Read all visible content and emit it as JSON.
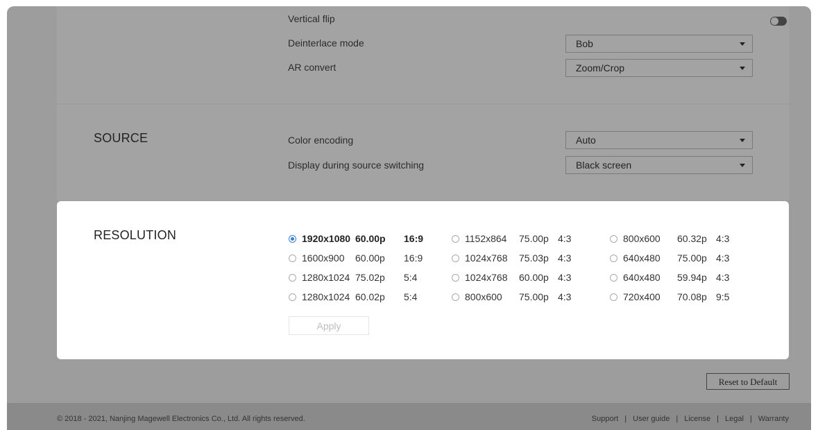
{
  "video": {
    "vertical_flip_label": "Vertical flip",
    "vertical_flip_on": false,
    "deinterlace_label": "Deinterlace mode",
    "deinterlace_value": "Bob",
    "ar_label": "AR convert",
    "ar_value": "Zoom/Crop"
  },
  "source": {
    "title": "SOURCE",
    "color_encoding_label": "Color encoding",
    "color_encoding_value": "Auto",
    "switching_label": "Display during source switching",
    "switching_value": "Black screen"
  },
  "resolution": {
    "title": "RESOLUTION",
    "selected_index": 0,
    "options": [
      {
        "res": "1920x1080",
        "fps": "60.00p",
        "aspect": "16:9"
      },
      {
        "res": "1600x900",
        "fps": "60.00p",
        "aspect": "16:9"
      },
      {
        "res": "1280x1024",
        "fps": "75.02p",
        "aspect": "5:4"
      },
      {
        "res": "1280x1024",
        "fps": "60.02p",
        "aspect": "5:4"
      },
      {
        "res": "1152x864",
        "fps": "75.00p",
        "aspect": "4:3"
      },
      {
        "res": "1024x768",
        "fps": "75.03p",
        "aspect": "4:3"
      },
      {
        "res": "1024x768",
        "fps": "60.00p",
        "aspect": "4:3"
      },
      {
        "res": "800x600",
        "fps": "75.00p",
        "aspect": "4:3"
      },
      {
        "res": "800x600",
        "fps": "60.32p",
        "aspect": "4:3"
      },
      {
        "res": "640x480",
        "fps": "75.00p",
        "aspect": "4:3"
      },
      {
        "res": "640x480",
        "fps": "59.94p",
        "aspect": "4:3"
      },
      {
        "res": "720x400",
        "fps": "70.08p",
        "aspect": "9:5"
      }
    ],
    "apply_label": "Apply"
  },
  "reset_label": "Reset to Default",
  "footer": {
    "copyright": "© 2018 - 2021, Nanjing Magewell Electronics Co., Ltd. All rights reserved.",
    "links": [
      "Support",
      "User guide",
      "License",
      "Legal",
      "Warranty"
    ]
  },
  "colors": {
    "accent": "#3a7bd5",
    "overlay": "#9d9d9d",
    "footer": "#8a8a8a"
  }
}
